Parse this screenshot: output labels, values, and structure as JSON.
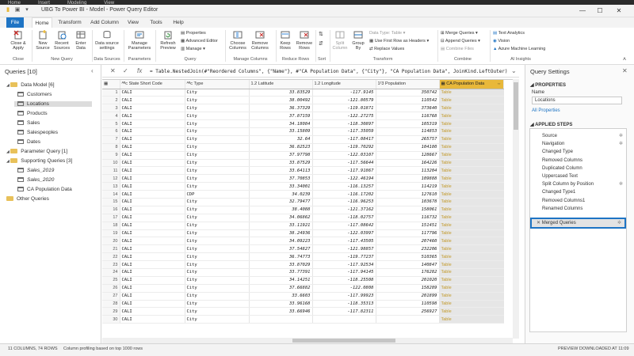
{
  "topstrip": [
    "Home",
    "Insert",
    "Modeling",
    "View"
  ],
  "title": "UBG To Power BI - Model - Power Query Editor",
  "tabs": [
    "File",
    "Home",
    "Transform",
    "Add Column",
    "View",
    "Tools",
    "Help"
  ],
  "ribbon": {
    "close": {
      "btn": "Close & Apply",
      "group": "Close"
    },
    "newquery": {
      "new_source": "New Source",
      "recent": "Recent Sources",
      "enter": "Enter Data",
      "group": "New Query"
    },
    "ds": {
      "btn": "Data source settings",
      "group": "Data Sources"
    },
    "params": {
      "btn": "Manage Parameters",
      "group": "Parameters"
    },
    "query": {
      "refresh": "Refresh Preview",
      "properties": "Properties",
      "adv": "Advanced Editor",
      "manage": "Manage",
      "group": "Query"
    },
    "cols": {
      "choose": "Choose Columns",
      "remove": "Remove Columns",
      "group": "Manage Columns"
    },
    "rows": {
      "keep": "Keep Rows",
      "remove": "Remove Rows",
      "group": "Reduce Rows"
    },
    "sort": {
      "group": "Sort"
    },
    "transform": {
      "split": "Split Column",
      "groupby": "Group By",
      "dtype": "Data Type: Table",
      "firstrow": "Use First Row as Headers",
      "replace": "Replace Values",
      "group": "Transform"
    },
    "combine": {
      "merge": "Merge Queries",
      "append": "Append Queries",
      "files": "Combine Files",
      "group": "Combine"
    },
    "ai": {
      "text": "Text Analytics",
      "vision": "Vision",
      "ml": "Azure Machine Learning",
      "group": "AI Insights"
    }
  },
  "queries": {
    "header": "Queries [10]",
    "items": [
      {
        "label": "Data Model [6]",
        "kind": "folder"
      },
      {
        "label": "Customers",
        "kind": "table"
      },
      {
        "label": "Locations",
        "kind": "table"
      },
      {
        "label": "Products",
        "kind": "table"
      },
      {
        "label": "Sales",
        "kind": "table"
      },
      {
        "label": "Salespeoples",
        "kind": "table"
      },
      {
        "label": "Dates",
        "kind": "table"
      },
      {
        "label": "Parameter Query [1]",
        "kind": "folder"
      },
      {
        "label": "Supporting Queries [3]",
        "kind": "folder"
      },
      {
        "label": "Sales_2019",
        "kind": "table"
      },
      {
        "label": "Sales_2020",
        "kind": "table"
      },
      {
        "label": "CA Population Data",
        "kind": "table"
      },
      {
        "label": "Other Queries",
        "kind": "folder"
      }
    ]
  },
  "formula": "= Table.NestedJoin(#\"Reordered Columns\", {\"Name\"}, #\"CA Population Data\", {\"City\"}, \"CA Population Data\", JoinKind.LeftOuter)",
  "grid": {
    "headers": [
      "State Short Code",
      "Type",
      "Latitude",
      "Longitude",
      "Population",
      "CA Population Data"
    ],
    "rows": [
      [
        "1",
        "CALI",
        "City",
        "33.83529",
        "-117.9145",
        "350742",
        "Table"
      ],
      [
        "2",
        "CALI",
        "City",
        "38.00492",
        "-121.80579",
        "110542",
        "Table"
      ],
      [
        "3",
        "CALI",
        "City",
        "36.37329",
        "-119.01871",
        "373640",
        "Table"
      ],
      [
        "4",
        "CALI",
        "City",
        "37.87159",
        "-122.27275",
        "116768",
        "Table"
      ],
      [
        "5",
        "CALI",
        "City",
        "34.18084",
        "-118.30897",
        "105319",
        "Table"
      ],
      [
        "6",
        "CALI",
        "City",
        "33.15809",
        "-117.35059",
        "114853",
        "Table"
      ],
      [
        "7",
        "CALI",
        "City",
        "32.64",
        "-117.08417",
        "265757",
        "Table"
      ],
      [
        "8",
        "CALI",
        "City",
        "36.82523",
        "-119.70292",
        "104180",
        "Table"
      ],
      [
        "9",
        "CALI",
        "City",
        "37.97798",
        "-122.03107",
        "128667",
        "Table"
      ],
      [
        "10",
        "CALI",
        "City",
        "33.87529",
        "-117.56644",
        "164226",
        "Table"
      ],
      [
        "11",
        "CALI",
        "City",
        "33.64113",
        "-117.91867",
        "113204",
        "Table"
      ],
      [
        "12",
        "CALI",
        "City",
        "37.70853",
        "-122.46194",
        "109888",
        "Table"
      ],
      [
        "13",
        "CALI",
        "City",
        "33.34001",
        "-116.13257",
        "114219",
        "Table"
      ],
      [
        "14",
        "CALI",
        "CDP",
        "34.0239",
        "-116.17202",
        "127610",
        "Table"
      ],
      [
        "15",
        "CALI",
        "City",
        "32.79477",
        "-116.96253",
        "103678",
        "Table"
      ],
      [
        "16",
        "CALI",
        "City",
        "38.4088",
        "-121.37162",
        "158061",
        "Table"
      ],
      [
        "17",
        "CALI",
        "City",
        "34.06862",
        "-118.02757",
        "116732",
        "Table"
      ],
      [
        "18",
        "CALI",
        "City",
        "33.11921",
        "-117.08642",
        "151451",
        "Table"
      ],
      [
        "19",
        "CALI",
        "City",
        "38.24936",
        "-122.03997",
        "117796",
        "Table"
      ],
      [
        "20",
        "CALI",
        "City",
        "34.09223",
        "-117.43505",
        "207460",
        "Table"
      ],
      [
        "21",
        "CALI",
        "City",
        "37.54827",
        "-121.98857",
        "232206",
        "Table"
      ],
      [
        "22",
        "CALI",
        "City",
        "36.74773",
        "-119.77237",
        "510365",
        "Table"
      ],
      [
        "23",
        "CALI",
        "City",
        "33.87029",
        "-117.92534",
        "140847",
        "Table"
      ],
      [
        "24",
        "CALI",
        "City",
        "33.77391",
        "-117.94145",
        "176282",
        "Table"
      ],
      [
        "25",
        "CALI",
        "City",
        "34.14251",
        "-118.25508",
        "201020",
        "Table"
      ],
      [
        "26",
        "CALI",
        "City",
        "37.66882",
        "-122.0808",
        "158289",
        "Table"
      ],
      [
        "27",
        "CALI",
        "City",
        "33.6603",
        "-117.99923",
        "201899",
        "Table"
      ],
      [
        "28",
        "CALI",
        "City",
        "33.96168",
        "-118.35313",
        "110598",
        "Table"
      ],
      [
        "29",
        "CALI",
        "City",
        "33.66946",
        "-117.82311",
        "256927",
        "Table"
      ],
      [
        "30",
        "CALI",
        "City",
        "",
        "",
        "",
        "Table"
      ]
    ]
  },
  "settings": {
    "header": "Query Settings",
    "properties_title": "PROPERTIES",
    "name_label": "Name",
    "name_value": "Locations",
    "all_props": "All Properties",
    "steps_title": "APPLIED STEPS",
    "steps": [
      {
        "label": "Source",
        "gear": true
      },
      {
        "label": "Navigation",
        "gear": true
      },
      {
        "label": "Changed Type",
        "gear": false
      },
      {
        "label": "Removed Columns",
        "gear": false
      },
      {
        "label": "Duplicated Column",
        "gear": false
      },
      {
        "label": "Uppercased Text",
        "gear": false
      },
      {
        "label": "Split Column by Position",
        "gear": true
      },
      {
        "label": "Changed Type1",
        "gear": false
      },
      {
        "label": "Removed Columns1",
        "gear": false
      },
      {
        "label": "Renamed Columns",
        "gear": false
      },
      {
        "label": "Merged Queries",
        "gear": true,
        "selected": true
      }
    ]
  },
  "status": {
    "left": "11 COLUMNS, 74 ROWS",
    "mid": "Column profiling based on top 1000 rows",
    "right": "PREVIEW DOWNLOADED AT 11:09"
  },
  "colors": {
    "accent": "#1e74c4",
    "highlight": "#e8b83a",
    "table_text": "#c39a2a"
  }
}
